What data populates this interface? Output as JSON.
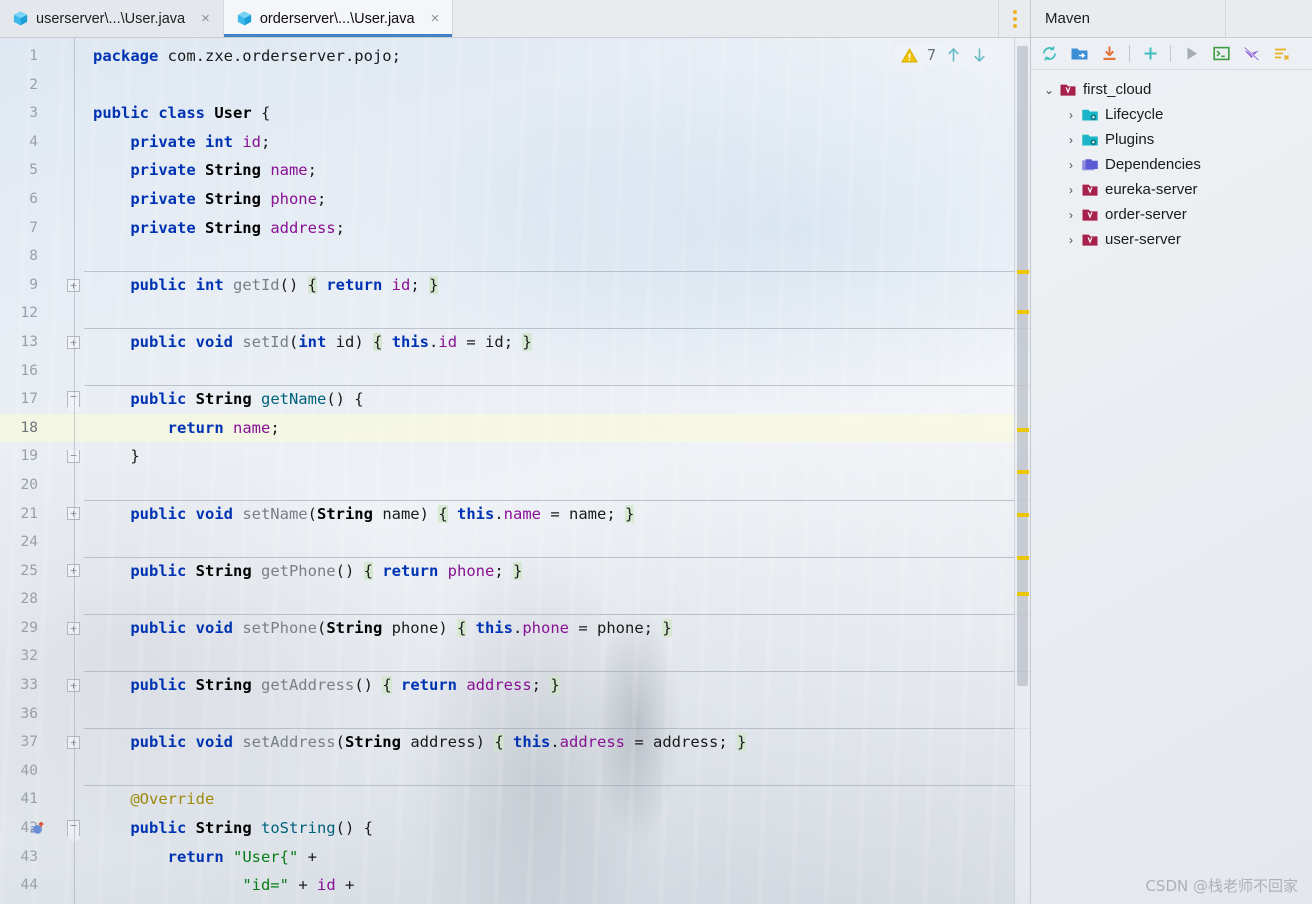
{
  "tabs": [
    {
      "label": "userserver\\...\\User.java",
      "icon": "java-class-icon",
      "active": false,
      "close": "×"
    },
    {
      "label": "orderserver\\...\\User.java",
      "icon": "java-class-icon",
      "active": true,
      "close": "×"
    }
  ],
  "editor": {
    "inspection_count": "7",
    "inspection_icon": "warning-triangle-icon",
    "prev_icon": "arrow-up-icon",
    "next_icon": "arrow-down-icon",
    "options_icon": "more-options-icon",
    "current_line": 18,
    "line_numbers": [
      1,
      2,
      3,
      4,
      5,
      6,
      7,
      8,
      9,
      12,
      13,
      16,
      17,
      18,
      19,
      20,
      21,
      24,
      25,
      28,
      29,
      32,
      33,
      36,
      37,
      40,
      41,
      42,
      43,
      44
    ],
    "lines": [
      {
        "n": 1,
        "sep": false,
        "tokens": [
          {
            "t": "package ",
            "c": "kw"
          },
          {
            "t": "com.zxe.orderserver.pojo;",
            "c": "plain"
          }
        ]
      },
      {
        "n": 2,
        "sep": false,
        "tokens": []
      },
      {
        "n": 3,
        "sep": false,
        "tokens": [
          {
            "t": "public class ",
            "c": "kw"
          },
          {
            "t": "User",
            "c": "cls"
          },
          {
            "t": " {",
            "c": "plain"
          }
        ]
      },
      {
        "n": 4,
        "sep": false,
        "tokens": [
          {
            "t": "    ",
            "c": "plain"
          },
          {
            "t": "private int ",
            "c": "kw"
          },
          {
            "t": "id",
            "c": "fld"
          },
          {
            "t": ";",
            "c": "plain"
          }
        ]
      },
      {
        "n": 5,
        "sep": false,
        "tokens": [
          {
            "t": "    ",
            "c": "plain"
          },
          {
            "t": "private ",
            "c": "kw"
          },
          {
            "t": "String ",
            "c": "cls"
          },
          {
            "t": "name",
            "c": "fld"
          },
          {
            "t": ";",
            "c": "plain"
          }
        ]
      },
      {
        "n": 6,
        "sep": false,
        "tokens": [
          {
            "t": "    ",
            "c": "plain"
          },
          {
            "t": "private ",
            "c": "kw"
          },
          {
            "t": "String ",
            "c": "cls"
          },
          {
            "t": "phone",
            "c": "fld"
          },
          {
            "t": ";",
            "c": "plain"
          }
        ]
      },
      {
        "n": 7,
        "sep": false,
        "tokens": [
          {
            "t": "    ",
            "c": "plain"
          },
          {
            "t": "private ",
            "c": "kw"
          },
          {
            "t": "String ",
            "c": "cls"
          },
          {
            "t": "address",
            "c": "fld"
          },
          {
            "t": ";",
            "c": "plain"
          }
        ]
      },
      {
        "n": 8,
        "sep": false,
        "tokens": []
      },
      {
        "n": 9,
        "sep": true,
        "fold": "plus",
        "tokens": [
          {
            "t": "    ",
            "c": "plain"
          },
          {
            "t": "public int ",
            "c": "kw"
          },
          {
            "t": "getId",
            "c": "mthg"
          },
          {
            "t": "() ",
            "c": "plain"
          },
          {
            "t": "{",
            "c": "br"
          },
          {
            "t": " ",
            "c": "plain"
          },
          {
            "t": "return ",
            "c": "kw"
          },
          {
            "t": "id",
            "c": "fld"
          },
          {
            "t": "; ",
            "c": "plain"
          },
          {
            "t": "}",
            "c": "br"
          }
        ]
      },
      {
        "n": 12,
        "sep": false,
        "tokens": []
      },
      {
        "n": 13,
        "sep": true,
        "fold": "plus",
        "tokens": [
          {
            "t": "    ",
            "c": "plain"
          },
          {
            "t": "public void ",
            "c": "kw"
          },
          {
            "t": "setId",
            "c": "mthg"
          },
          {
            "t": "(",
            "c": "plain"
          },
          {
            "t": "int ",
            "c": "kw"
          },
          {
            "t": "id",
            "c": "plain"
          },
          {
            "t": ") ",
            "c": "plain"
          },
          {
            "t": "{",
            "c": "br"
          },
          {
            "t": " ",
            "c": "plain"
          },
          {
            "t": "this",
            "c": "kw"
          },
          {
            "t": ".",
            "c": "plain"
          },
          {
            "t": "id",
            "c": "fld"
          },
          {
            "t": " = id; ",
            "c": "plain"
          },
          {
            "t": "}",
            "c": "br"
          }
        ]
      },
      {
        "n": 16,
        "sep": false,
        "tokens": []
      },
      {
        "n": 17,
        "sep": true,
        "fold": "minus-top",
        "tokens": [
          {
            "t": "    ",
            "c": "plain"
          },
          {
            "t": "public ",
            "c": "kw"
          },
          {
            "t": "String ",
            "c": "cls"
          },
          {
            "t": "getName",
            "c": "mth"
          },
          {
            "t": "() {",
            "c": "plain"
          }
        ]
      },
      {
        "n": 18,
        "sep": false,
        "cur": true,
        "tokens": [
          {
            "t": "        ",
            "c": "plain"
          },
          {
            "t": "return ",
            "c": "kw"
          },
          {
            "t": "name",
            "c": "fld"
          },
          {
            "t": ";",
            "c": "plain"
          }
        ]
      },
      {
        "n": 19,
        "sep": false,
        "fold": "minus-bot",
        "tokens": [
          {
            "t": "    }",
            "c": "plain"
          }
        ]
      },
      {
        "n": 20,
        "sep": false,
        "tokens": []
      },
      {
        "n": 21,
        "sep": true,
        "fold": "plus",
        "tokens": [
          {
            "t": "    ",
            "c": "plain"
          },
          {
            "t": "public void ",
            "c": "kw"
          },
          {
            "t": "setName",
            "c": "mthg"
          },
          {
            "t": "(",
            "c": "plain"
          },
          {
            "t": "String ",
            "c": "cls"
          },
          {
            "t": "name",
            "c": "plain"
          },
          {
            "t": ") ",
            "c": "plain"
          },
          {
            "t": "{",
            "c": "br"
          },
          {
            "t": " ",
            "c": "plain"
          },
          {
            "t": "this",
            "c": "kw"
          },
          {
            "t": ".",
            "c": "plain"
          },
          {
            "t": "name",
            "c": "fld"
          },
          {
            "t": " = name; ",
            "c": "plain"
          },
          {
            "t": "}",
            "c": "br"
          }
        ]
      },
      {
        "n": 24,
        "sep": false,
        "tokens": []
      },
      {
        "n": 25,
        "sep": true,
        "fold": "plus",
        "tokens": [
          {
            "t": "    ",
            "c": "plain"
          },
          {
            "t": "public ",
            "c": "kw"
          },
          {
            "t": "String ",
            "c": "cls"
          },
          {
            "t": "getPhone",
            "c": "mthg"
          },
          {
            "t": "() ",
            "c": "plain"
          },
          {
            "t": "{",
            "c": "br"
          },
          {
            "t": " ",
            "c": "plain"
          },
          {
            "t": "return ",
            "c": "kw"
          },
          {
            "t": "phone",
            "c": "fld"
          },
          {
            "t": "; ",
            "c": "plain"
          },
          {
            "t": "}",
            "c": "br"
          }
        ]
      },
      {
        "n": 28,
        "sep": false,
        "tokens": []
      },
      {
        "n": 29,
        "sep": true,
        "fold": "plus",
        "tokens": [
          {
            "t": "    ",
            "c": "plain"
          },
          {
            "t": "public void ",
            "c": "kw"
          },
          {
            "t": "setPhone",
            "c": "mthg"
          },
          {
            "t": "(",
            "c": "plain"
          },
          {
            "t": "String ",
            "c": "cls"
          },
          {
            "t": "phone",
            "c": "plain"
          },
          {
            "t": ") ",
            "c": "plain"
          },
          {
            "t": "{",
            "c": "br"
          },
          {
            "t": " ",
            "c": "plain"
          },
          {
            "t": "this",
            "c": "kw"
          },
          {
            "t": ".",
            "c": "plain"
          },
          {
            "t": "phone",
            "c": "fld"
          },
          {
            "t": " = phone; ",
            "c": "plain"
          },
          {
            "t": "}",
            "c": "br"
          }
        ]
      },
      {
        "n": 32,
        "sep": false,
        "tokens": []
      },
      {
        "n": 33,
        "sep": true,
        "fold": "plus",
        "tokens": [
          {
            "t": "    ",
            "c": "plain"
          },
          {
            "t": "public ",
            "c": "kw"
          },
          {
            "t": "String ",
            "c": "cls"
          },
          {
            "t": "getAddress",
            "c": "mthg"
          },
          {
            "t": "() ",
            "c": "plain"
          },
          {
            "t": "{",
            "c": "br"
          },
          {
            "t": " ",
            "c": "plain"
          },
          {
            "t": "return ",
            "c": "kw"
          },
          {
            "t": "address",
            "c": "fld"
          },
          {
            "t": "; ",
            "c": "plain"
          },
          {
            "t": "}",
            "c": "br"
          }
        ]
      },
      {
        "n": 36,
        "sep": false,
        "tokens": []
      },
      {
        "n": 37,
        "sep": true,
        "fold": "plus",
        "tokens": [
          {
            "t": "    ",
            "c": "plain"
          },
          {
            "t": "public void ",
            "c": "kw"
          },
          {
            "t": "setAddress",
            "c": "mthg"
          },
          {
            "t": "(",
            "c": "plain"
          },
          {
            "t": "String ",
            "c": "cls"
          },
          {
            "t": "address",
            "c": "plain"
          },
          {
            "t": ") ",
            "c": "plain"
          },
          {
            "t": "{",
            "c": "br"
          },
          {
            "t": " ",
            "c": "plain"
          },
          {
            "t": "this",
            "c": "kw"
          },
          {
            "t": ".",
            "c": "plain"
          },
          {
            "t": "address",
            "c": "fld"
          },
          {
            "t": " = address; ",
            "c": "plain"
          },
          {
            "t": "}",
            "c": "br"
          }
        ]
      },
      {
        "n": 40,
        "sep": false,
        "tokens": []
      },
      {
        "n": 41,
        "sep": true,
        "tokens": [
          {
            "t": "    ",
            "c": "plain"
          },
          {
            "t": "@Override",
            "c": "ann"
          }
        ]
      },
      {
        "n": 42,
        "sep": false,
        "fold": "minus-top",
        "override": true,
        "tokens": [
          {
            "t": "    ",
            "c": "plain"
          },
          {
            "t": "public ",
            "c": "kw"
          },
          {
            "t": "String ",
            "c": "cls"
          },
          {
            "t": "toString",
            "c": "mth"
          },
          {
            "t": "() {",
            "c": "plain"
          }
        ]
      },
      {
        "n": 43,
        "sep": false,
        "tokens": [
          {
            "t": "        ",
            "c": "plain"
          },
          {
            "t": "return ",
            "c": "kw"
          },
          {
            "t": "\"User{\"",
            "c": "str"
          },
          {
            "t": " +",
            "c": "plain"
          }
        ]
      },
      {
        "n": 44,
        "sep": false,
        "tokens": [
          {
            "t": "                ",
            "c": "plain"
          },
          {
            "t": "\"id=\"",
            "c": "str"
          },
          {
            "t": " + ",
            "c": "plain"
          },
          {
            "t": "id",
            "c": "fld"
          },
          {
            "t": " +",
            "c": "plain"
          }
        ]
      }
    ],
    "markers": [
      232,
      272,
      390,
      432,
      475,
      518,
      554
    ],
    "marker_color": "#eac700"
  },
  "maven": {
    "title": "Maven",
    "toolbar": [
      {
        "name": "reload-all-maven-projects-icon",
        "color": "#3dbfbf"
      },
      {
        "name": "add-maven-project-icon",
        "color": "#3c8ed6"
      },
      {
        "name": "download-sources-icon",
        "color": "#e8733c"
      },
      {
        "name": "add-icon",
        "color": "#3dbfbf"
      },
      {
        "name": "run-maven-build-icon",
        "color": "#a6acb4"
      },
      {
        "name": "open-terminal-icon",
        "color": "#3f9b3f"
      },
      {
        "name": "toggle-offline-mode-icon",
        "color": "#8f68d4"
      },
      {
        "name": "collapse-all-icon",
        "color": "#e8b21f"
      }
    ],
    "tree": [
      {
        "label": "first_cloud",
        "depth": 0,
        "twisty": "⌄",
        "expanded": true,
        "icon": "maven-project-icon"
      },
      {
        "label": "Lifecycle",
        "depth": 1,
        "twisty": "›",
        "expanded": false,
        "icon": "lifecycle-icon"
      },
      {
        "label": "Plugins",
        "depth": 1,
        "twisty": "›",
        "expanded": false,
        "icon": "plugins-icon"
      },
      {
        "label": "Dependencies",
        "depth": 1,
        "twisty": "›",
        "expanded": false,
        "icon": "dependencies-icon"
      },
      {
        "label": "eureka-server",
        "depth": 1,
        "twisty": "›",
        "expanded": false,
        "icon": "maven-module-icon"
      },
      {
        "label": "order-server",
        "depth": 1,
        "twisty": "›",
        "expanded": false,
        "icon": "maven-module-icon"
      },
      {
        "label": "user-server",
        "depth": 1,
        "twisty": "›",
        "expanded": false,
        "icon": "maven-module-icon"
      }
    ]
  },
  "watermark": "CSDN @栈老师不回家",
  "colors": {
    "accent_tab": "#4083c9",
    "warning": "#eac700",
    "keyword": "#0033b3",
    "field": "#871094",
    "string": "#067d17",
    "annotation": "#9e880d",
    "method": "#00627a"
  }
}
